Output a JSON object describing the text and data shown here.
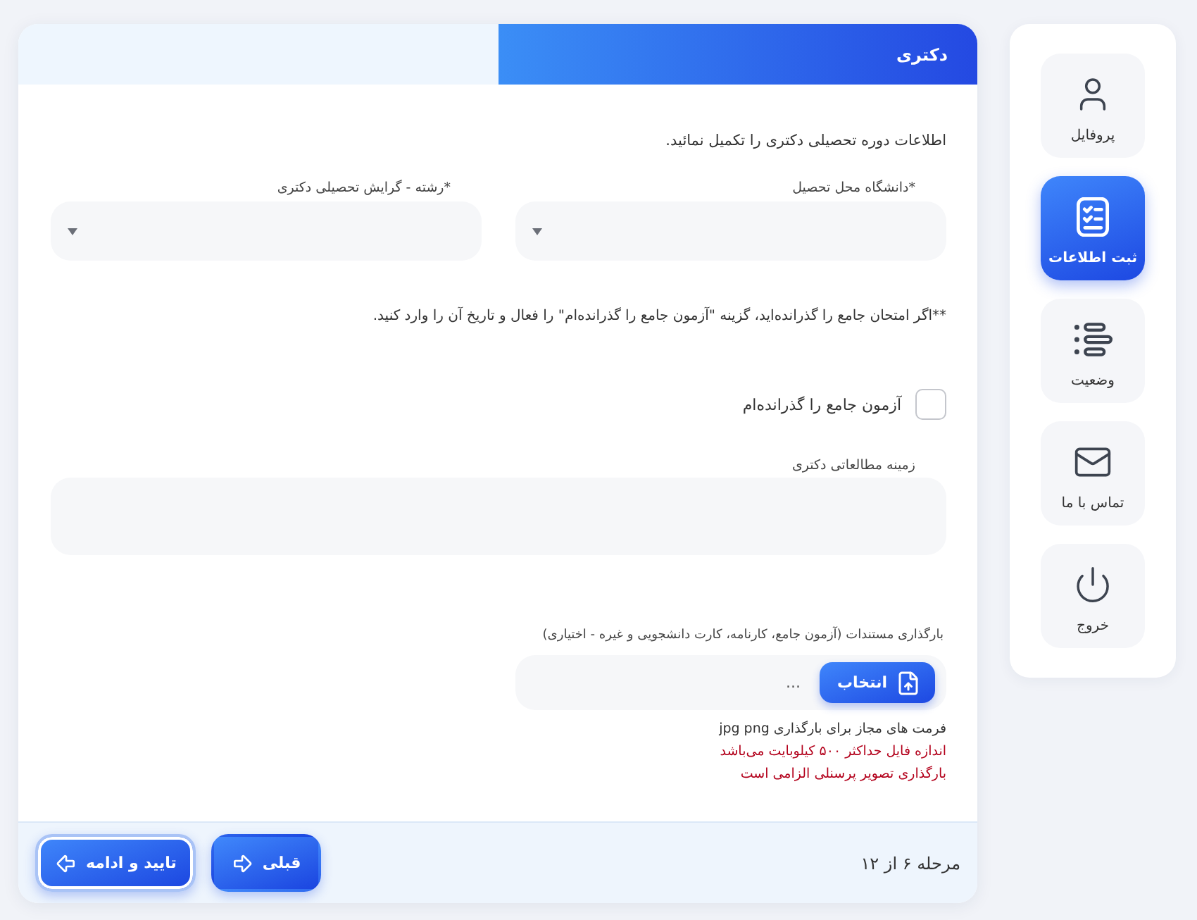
{
  "sidebar": {
    "items": [
      {
        "kind": "profile",
        "label": "پروفایل",
        "selected": false
      },
      {
        "kind": "register",
        "label": "ثبت اطلاعات",
        "selected": true
      },
      {
        "kind": "status",
        "label": "وضعیت",
        "selected": false
      },
      {
        "kind": "contact",
        "label": "تماس با ما",
        "selected": false
      },
      {
        "kind": "exit",
        "label": "خروج",
        "selected": false
      }
    ]
  },
  "form": {
    "title": "دکتری",
    "intro": "اطلاعات دوره تحصیلی دکتری را تکمیل نمائید.",
    "selects": [
      {
        "label": "*دانشگاه محل تحصیل"
      },
      {
        "label": "*رشته - گرایش تحصیلی دکتری"
      }
    ],
    "note": "**اگر امتحان جامع را گذرانده‌اید، گزینه \"آزمون جامع را گذرانده‌ام\" را فعال و تاریخ آن را وارد کنید.",
    "checkbox": {
      "label": "آزمون جامع را گذرانده‌ام",
      "checked": false
    },
    "study_field": {
      "label": "زمینه مطالعاتی دکتری"
    },
    "upload": {
      "label": "بارگذاری مستندات (آزمون جامع، کارنامه، کارت دانشجویی و غیره - اختیاری)",
      "button": "انتخاب",
      "file_name": "..."
    },
    "hints": [
      {
        "kind": "info",
        "text": "فرمت های مجاز برای بارگذاری jpg png"
      },
      {
        "kind": "error",
        "text": "اندازه فایل حداکثر ۵۰۰ کیلوبایت می‌باشد"
      },
      {
        "kind": "error",
        "text": "بارگذاری تصویر پرسنلی الزامی است"
      }
    ]
  },
  "footer": {
    "step": "مرحله ۶ از ۱۲",
    "buttons": [
      {
        "kind": "back",
        "label": "قبلی",
        "focused": false
      },
      {
        "kind": "next",
        "label": "تایید و ادامه",
        "focused": true
      }
    ]
  }
}
